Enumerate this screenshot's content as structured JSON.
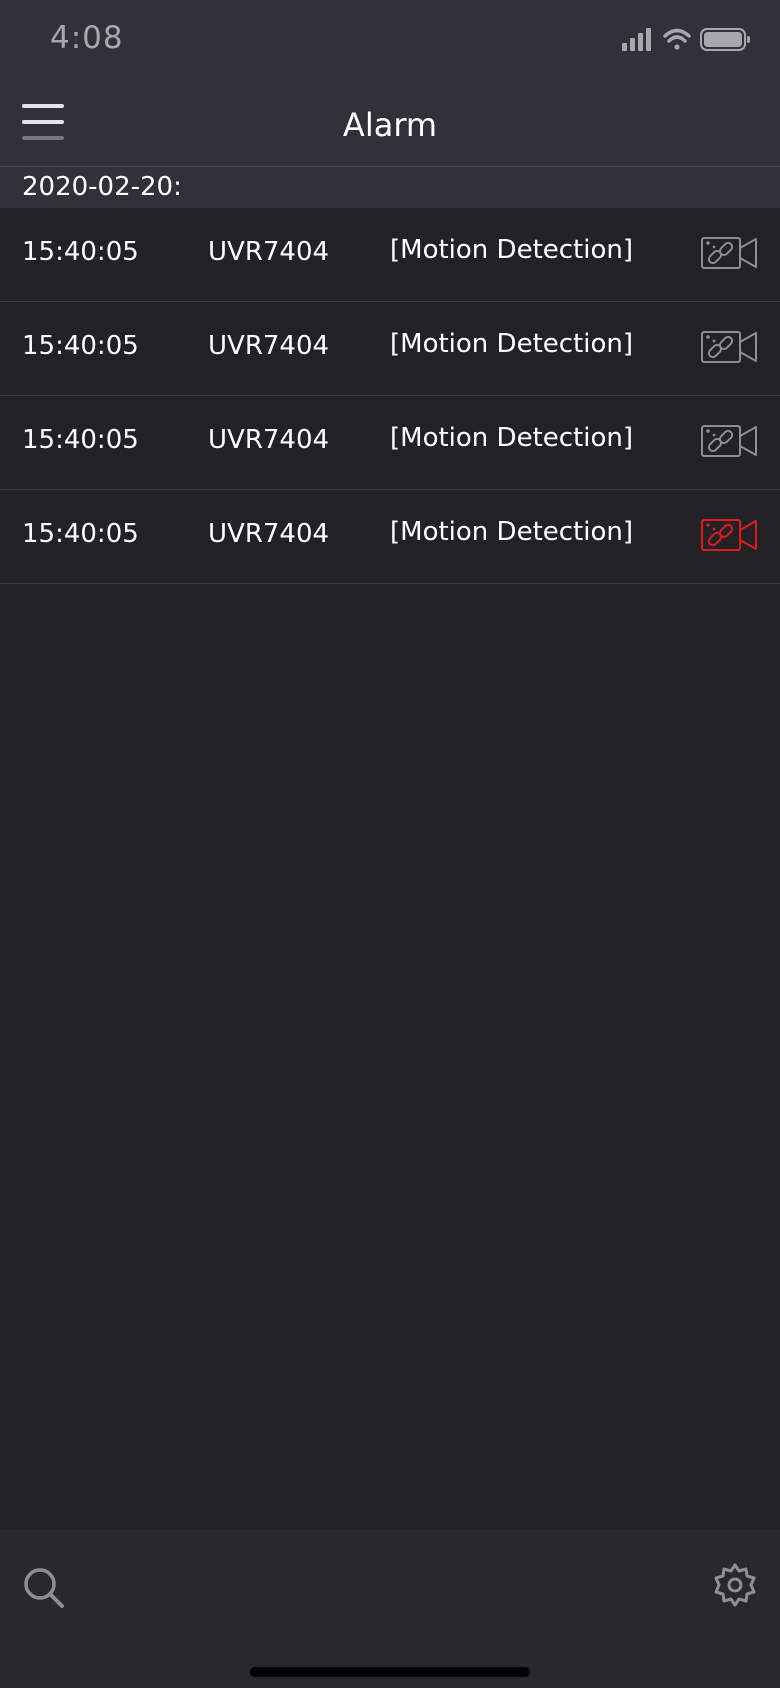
{
  "status_bar": {
    "time": "4:08",
    "icons": [
      "signal-icon",
      "wifi-icon",
      "battery-icon"
    ]
  },
  "header": {
    "title": "Alarm",
    "menu_icon": "hamburger-menu-icon"
  },
  "date_group": "2020-02-20:",
  "alarms": [
    {
      "time": "15:40:05",
      "device": "UVR7404",
      "type": "[Motion Detection]",
      "icon": "camera-link-icon",
      "icon_color": "#8e8f94"
    },
    {
      "time": "15:40:05",
      "device": "UVR7404",
      "type": "[Motion Detection]",
      "icon": "camera-link-icon",
      "icon_color": "#8e8f94"
    },
    {
      "time": "15:40:05",
      "device": "UVR7404",
      "type": "[Motion Detection]",
      "icon": "camera-link-icon",
      "icon_color": "#8e8f94"
    },
    {
      "time": "15:40:05",
      "device": "UVR7404",
      "type": "[Motion Detection]",
      "icon": "camera-link-icon",
      "icon_color": "#e0191f"
    }
  ],
  "bottom_bar": {
    "left_icon": "search-icon",
    "right_icon": "settings-gear-icon"
  },
  "colors": {
    "background": "#222226",
    "bar_background": "#303139",
    "accent_alarm": "#e0191f"
  }
}
